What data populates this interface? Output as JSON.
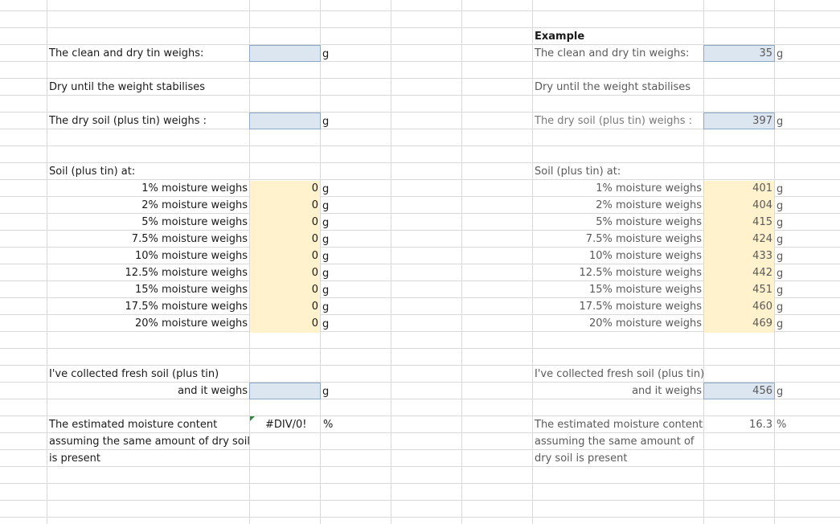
{
  "left": {
    "tin_label": "The clean and dry tin weighs:",
    "tin_unit": "g",
    "dry_note": "Dry until the weight stabilises",
    "drysoil_label": "The dry soil (plus tin) weighs :",
    "drysoil_unit": "g",
    "soil_at": "Soil (plus tin) at:",
    "rows": [
      {
        "label": "1% moisture weighs",
        "value": "0",
        "unit": "g"
      },
      {
        "label": "2% moisture weighs",
        "value": "0",
        "unit": "g"
      },
      {
        "label": "5% moisture weighs",
        "value": "0",
        "unit": "g"
      },
      {
        "label": "7.5% moisture weighs",
        "value": "0",
        "unit": "g"
      },
      {
        "label": "10% moisture weighs",
        "value": "0",
        "unit": "g"
      },
      {
        "label": "12.5% moisture weighs",
        "value": "0",
        "unit": "g"
      },
      {
        "label": "15% moisture weighs",
        "value": "0",
        "unit": "g"
      },
      {
        "label": "17.5% moisture weighs",
        "value": "0",
        "unit": "g"
      },
      {
        "label": "20% moisture weighs",
        "value": "0",
        "unit": "g"
      }
    ],
    "fresh_label": "I've collected fresh soil (plus tin)",
    "weighs_label": "and it weighs",
    "weighs_unit": "g",
    "est_line1": "The estimated moisture content",
    "est_line2": "assuming the same amount of dry soil",
    "est_line3": "is present",
    "est_value": "#DIV/0!",
    "est_unit": "%"
  },
  "right": {
    "example": "Example",
    "tin_label": "The clean and dry tin weighs:",
    "tin_value": "35",
    "tin_unit": "g",
    "dry_note": "Dry until the weight stabilises",
    "drysoil_label": "The dry soil (plus tin) weighs :",
    "drysoil_value": "397",
    "drysoil_unit": "g",
    "soil_at": "Soil (plus tin) at:",
    "rows": [
      {
        "label": "1% moisture weighs",
        "value": "401",
        "unit": "g"
      },
      {
        "label": "2% moisture weighs",
        "value": "404",
        "unit": "g"
      },
      {
        "label": "5% moisture weighs",
        "value": "415",
        "unit": "g"
      },
      {
        "label": "7.5% moisture weighs",
        "value": "424",
        "unit": "g"
      },
      {
        "label": "10% moisture weighs",
        "value": "433",
        "unit": "g"
      },
      {
        "label": "12.5% moisture weighs",
        "value": "442",
        "unit": "g"
      },
      {
        "label": "15% moisture weighs",
        "value": "451",
        "unit": "g"
      },
      {
        "label": "17.5% moisture weighs",
        "value": "460",
        "unit": "g"
      },
      {
        "label": "20% moisture weighs",
        "value": "469",
        "unit": "g"
      }
    ],
    "fresh_label": "I've collected fresh soil (plus tin)",
    "weighs_label": "and it weighs",
    "weighs_value": "456",
    "weighs_unit": "g",
    "est_line1": "The estimated moisture content",
    "est_line2": "assuming the same amount of",
    "est_line3": "dry soil is present",
    "est_value": "16.3",
    "est_unit": "%"
  },
  "colors": {
    "gridline": "#d9d9d9",
    "input_fill": "#dce6f1",
    "input_border": "#8ea9c8",
    "calc_fill": "#fff2cc",
    "error_marker": "#2e8b3e"
  }
}
